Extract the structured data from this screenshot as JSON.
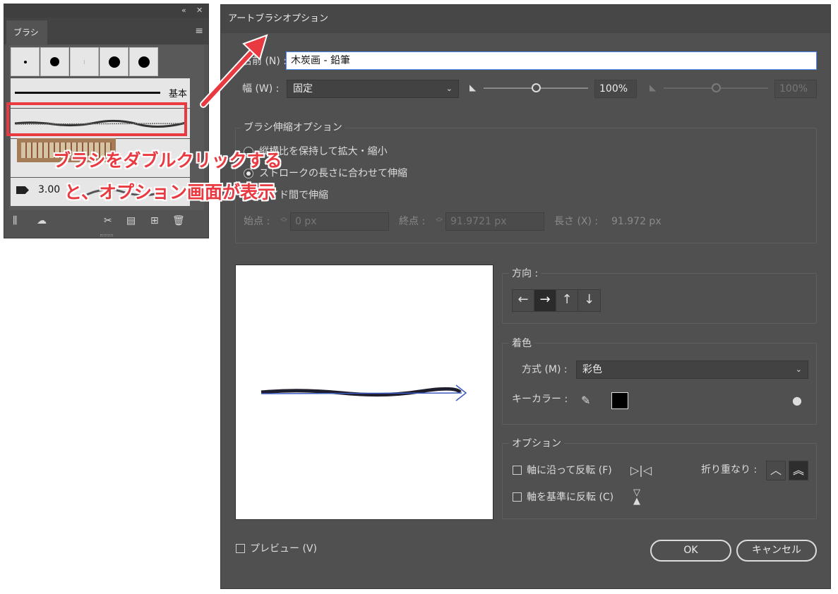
{
  "panel": {
    "tab_label": "ブラシ",
    "collapse_glyph": "«",
    "close_glyph": "✕",
    "menu_glyph": "≡",
    "kihon_label": "基本",
    "weight_value": "3.00",
    "footer_icons": [
      "brush-library-icon",
      "creative-cloud-library-icon",
      "remove-stroke-icon",
      "brush-options-icon",
      "new-brush-icon",
      "delete-brush-icon"
    ]
  },
  "annotation": {
    "line1": "ブラシをダブルクリックする",
    "line2": "と、オプション画面が表示",
    "color": "#e83a40"
  },
  "dialog": {
    "title": "アートブラシオプション",
    "name_label": "名前 (N) :",
    "name_value": "木炭画 - 鉛筆",
    "width_label": "幅 (W) :",
    "width_option": "固定",
    "width_percent": "100%",
    "width_percent_disabled": "100%",
    "scale_group_title": "ブラシ伸縮オプション",
    "radio_proportional": "縦横比を保持して拡大・縮小",
    "radio_stretch": "ストロークの長さに合わせて伸縮",
    "radio_guides": "ガイド間で伸縮",
    "start_label": "始点 :",
    "start_value": "0 px",
    "end_label": "終点 :",
    "end_value": "91.9721 px",
    "length_label": "長さ (X) :",
    "length_value": "91.972 px",
    "direction_label": "方向 :",
    "direction_buttons": [
      "←",
      "→",
      "↑",
      "↓"
    ],
    "colorization_title": "着色",
    "method_label": "方式 (M) :",
    "method_value": "彩色",
    "key_color_label": "キーカラー :",
    "key_color": "#000000",
    "options_title": "オプション",
    "flip_along_label": "軸に沿って反転 (F)",
    "flip_across_label": "軸を基準に反転 (C)",
    "overlap_label": "折り重なり :",
    "preview_label": "プレビュー (V)",
    "ok_label": "OK",
    "cancel_label": "キャンセル"
  }
}
